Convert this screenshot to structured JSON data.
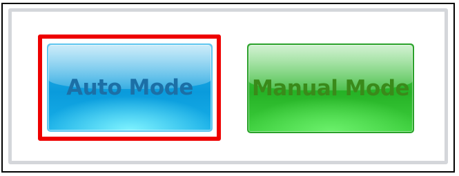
{
  "mode_selector": {
    "auto_label": "Auto Mode",
    "manual_label": "Manual Mode",
    "selected": "Auto Mode"
  },
  "colors": {
    "selection_outline": "#ee0000",
    "auto_button": "#0a9bdc",
    "auto_text": "#1c6fa6",
    "manual_button": "#26b226",
    "manual_text": "#3a8a1a",
    "panel_border": "#d4d6da"
  }
}
